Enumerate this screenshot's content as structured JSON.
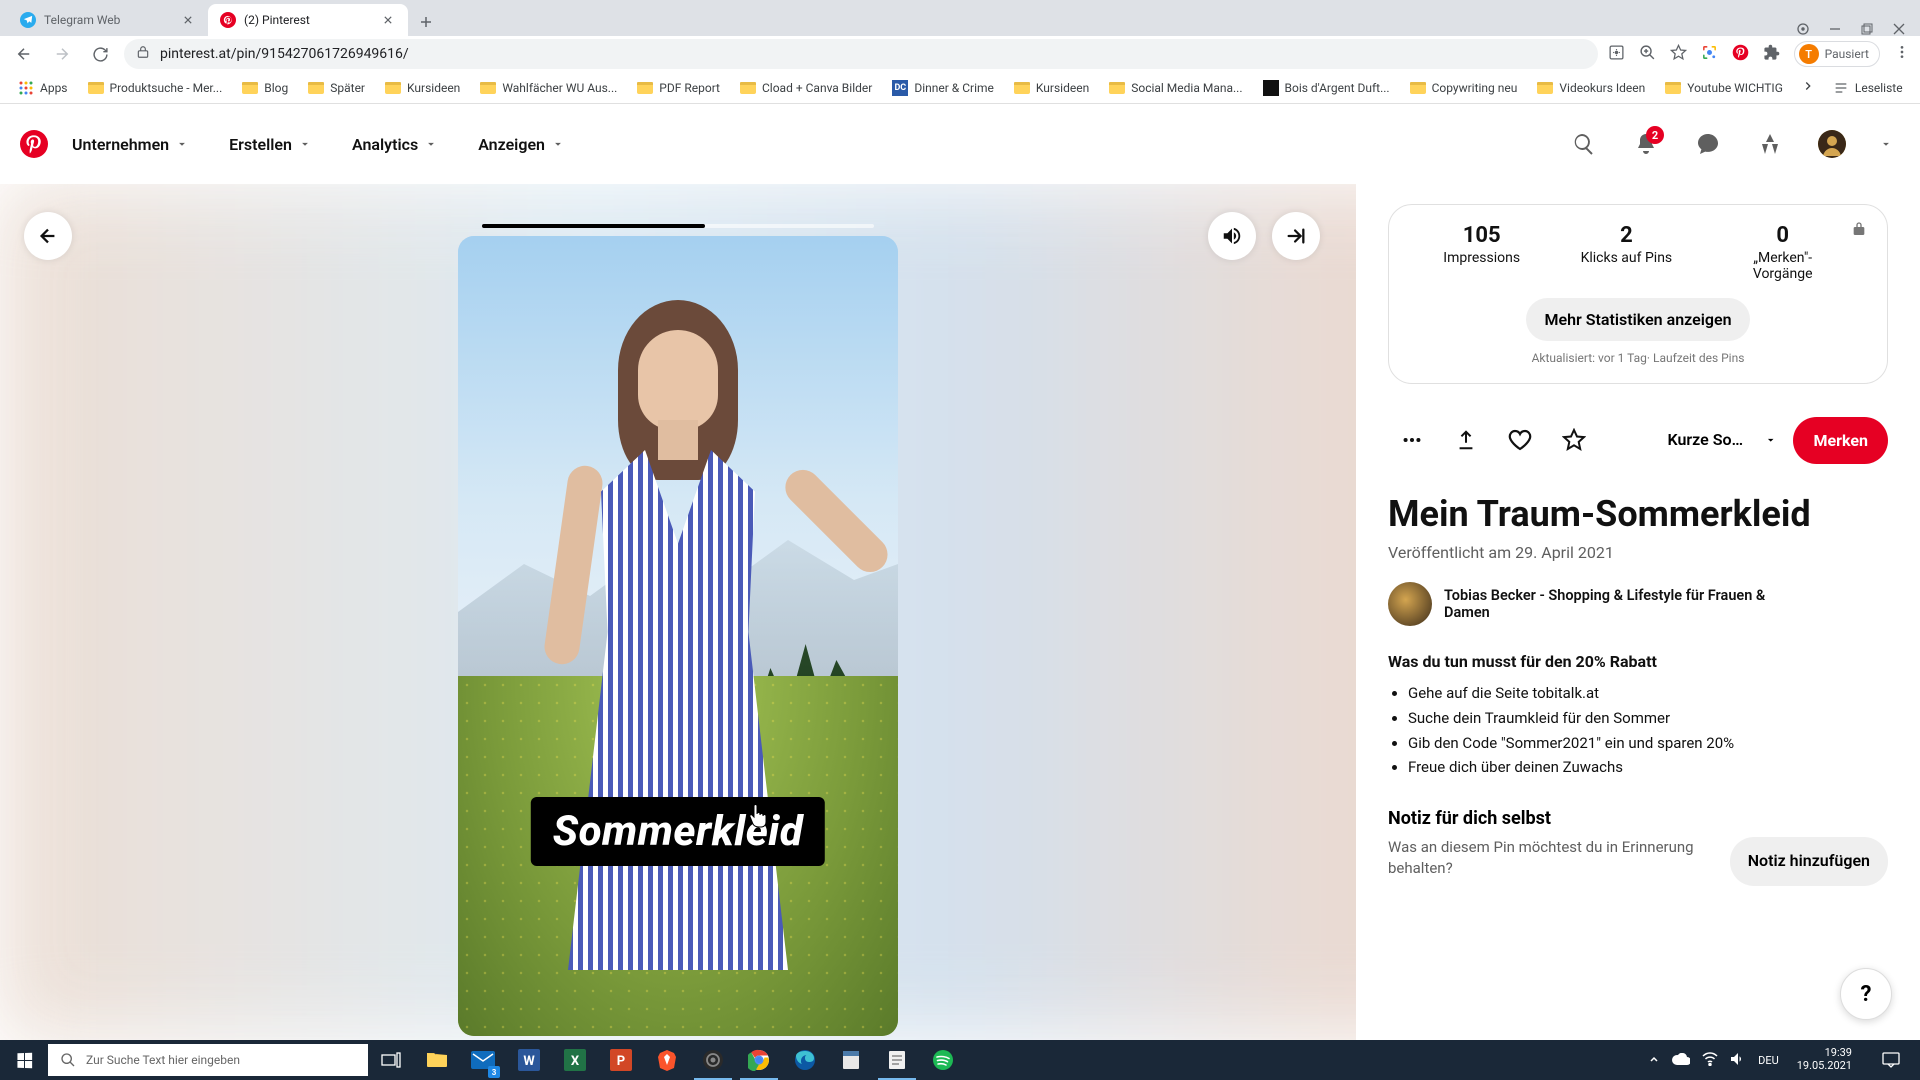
{
  "browser": {
    "tabs": [
      {
        "title": "Telegram Web"
      },
      {
        "title": "(2) Pinterest"
      }
    ],
    "url": "pinterest.at/pin/915427061726949616/",
    "paused_label": "Pausiert",
    "avatar_letter": "T",
    "bookmarks": [
      "Apps",
      "Produktsuche - Mer...",
      "Blog",
      "Später",
      "Kursideen",
      "Wahlfächer WU Aus...",
      "PDF Report",
      "Cload + Canva Bilder",
      "Dinner & Crime",
      "Kursideen",
      "Social Media Mana...",
      "Bois d'Argent Duft...",
      "Copywriting neu",
      "Videokurs Ideen",
      "Youtube WICHTIG"
    ],
    "reading_list_label": "Leseliste"
  },
  "header": {
    "nav": [
      "Unternehmen",
      "Erstellen",
      "Analytics",
      "Anzeigen"
    ],
    "notif_badge": "2"
  },
  "pin": {
    "caption": "Sommerkleid",
    "title": "Mein Traum-Sommerkleid",
    "published": "Veröffentlicht am 29. April 2021",
    "board_label": "Kurze Somm...",
    "save_label": "Merken",
    "author": "Tobias Becker - Shopping & Lifestyle für Frauen & Damen",
    "desc_heading": "Was du tun musst für den 20% Rabatt",
    "steps": [
      "Gehe auf die Seite tobitalk.at",
      "Suche dein Traumkleid für den Sommer",
      "Gib den Code \"Sommer2021\" ein und sparen 20%",
      "Freue dich über deinen Zuwachs"
    ],
    "note_heading": "Notiz für dich selbst",
    "note_question": "Was an diesem Pin möchtest du in Erinnerung behalten?",
    "note_button": "Notiz hinzufügen"
  },
  "stats": {
    "impressions": {
      "n": "105",
      "l": "Impressions"
    },
    "clicks": {
      "n": "2",
      "l": "Klicks auf Pins"
    },
    "saves": {
      "n": "0",
      "l": "„Merken\"-Vorgänge"
    },
    "more_button": "Mehr Statistiken anzeigen",
    "updated": "Aktualisiert: vor 1 Tag· Laufzeit des Pins"
  },
  "taskbar": {
    "search_placeholder": "Zur Suche Text hier eingeben",
    "mail_badge": "3",
    "lang": "DEU",
    "time": "19:39",
    "date": "19.05.2021"
  }
}
